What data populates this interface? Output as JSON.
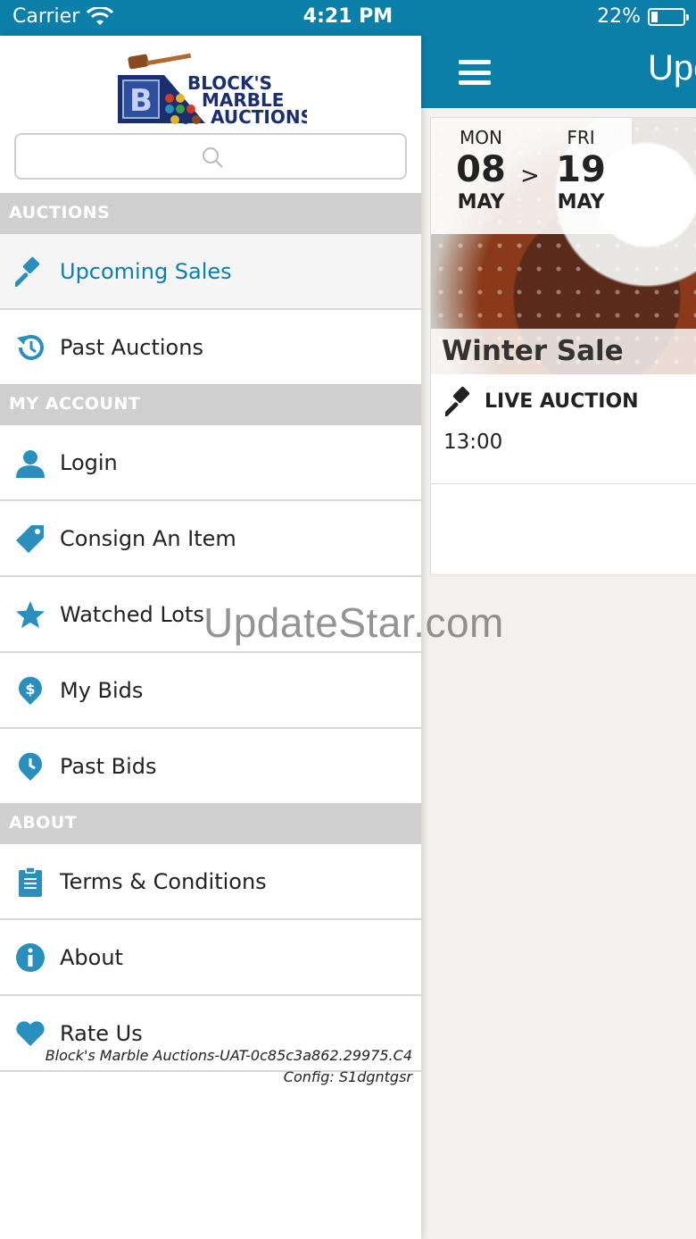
{
  "status_bar": {
    "carrier": "Carrier",
    "time": "4:21 PM",
    "battery": "22%",
    "battery_level": 0.22
  },
  "header": {
    "title": "Upc"
  },
  "card": {
    "start": {
      "dow": "MON",
      "day": "08",
      "month": "MAY"
    },
    "arrow": ">",
    "end": {
      "dow": "FRI",
      "day": "19",
      "month": "MAY"
    },
    "title": "Winter Sale",
    "auction_type": "LIVE AUCTION",
    "time": "13:00"
  },
  "drawer": {
    "logo": {
      "line1": "BLOCK'S",
      "line2": "MARBLE",
      "line3": "AUCTIONS",
      "letter": "B"
    },
    "search": {
      "placeholder": ""
    },
    "sections": {
      "auctions": "AUCTIONS",
      "account": "MY ACCOUNT",
      "about": "ABOUT"
    },
    "items": {
      "upcoming": "Upcoming Sales",
      "past_auctions": "Past Auctions",
      "login": "Login",
      "consign": "Consign An Item",
      "watched": "Watched Lots",
      "my_bids": "My Bids",
      "past_bids": "Past Bids",
      "terms": "Terms & Conditions",
      "about": "About",
      "rate": "Rate Us"
    },
    "footer": {
      "line1": "Block's Marble Auctions-UAT-0c85c3a862.29975.C4",
      "line2": "Config: S1dgntgsr"
    }
  },
  "watermark": "UpdateStar.com",
  "colors": {
    "brand": "#0b7fa8",
    "section_bg": "#cfcfcf",
    "icon": "#2a8fbd"
  },
  "icons": [
    "wifi-icon",
    "battery-icon",
    "hamburger-icon",
    "search-icon",
    "gavel-icon",
    "history-icon",
    "user-icon",
    "tag-icon",
    "star-icon",
    "dollar-pin-icon",
    "clock-pin-icon",
    "clipboard-icon",
    "info-icon",
    "heart-icon"
  ]
}
